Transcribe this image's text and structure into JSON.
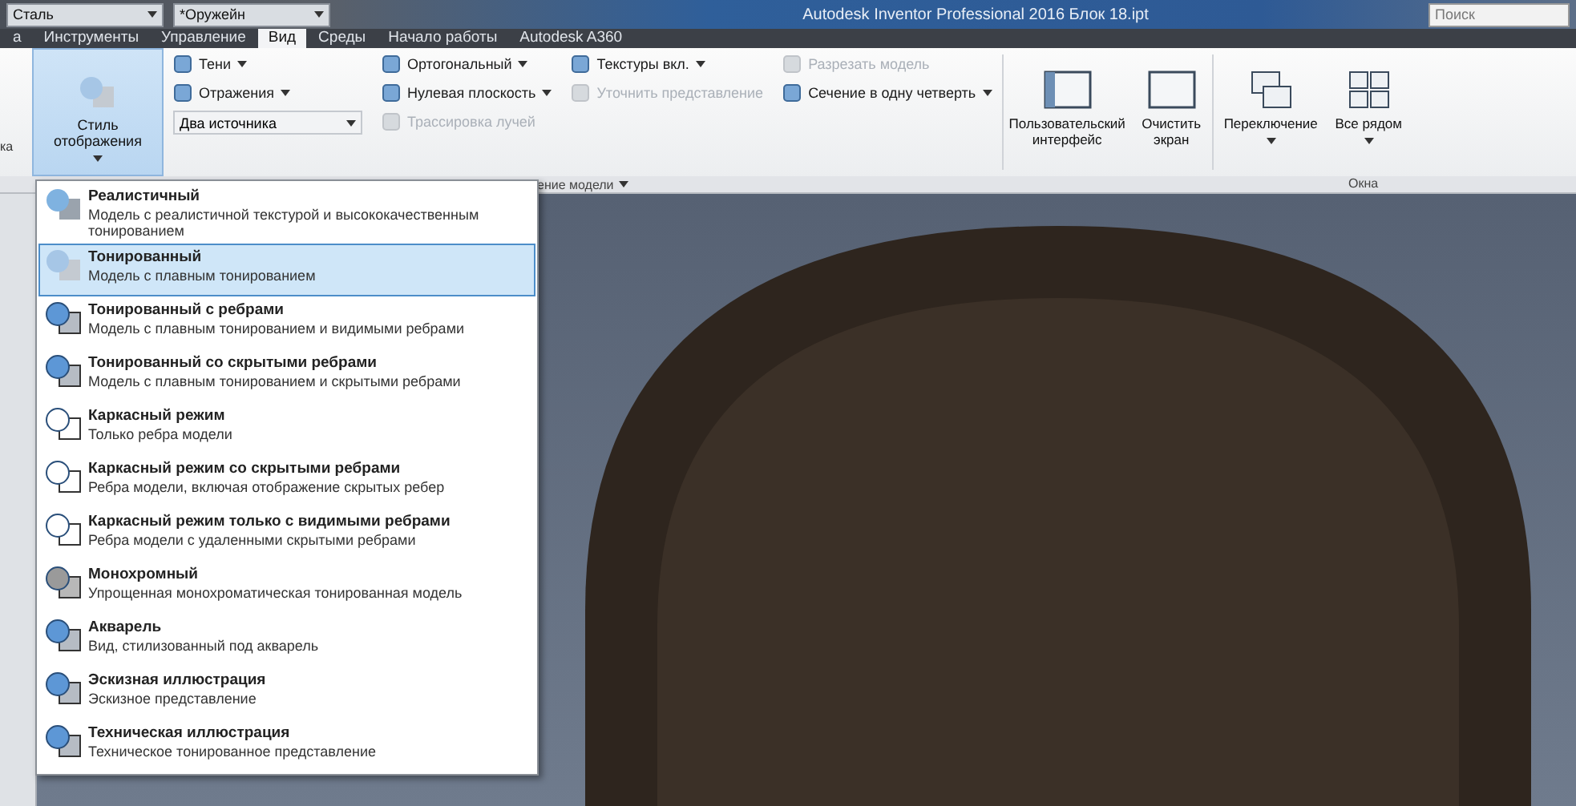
{
  "quick_access": {
    "material": "Сталь",
    "appearance": "*Оружейн"
  },
  "window": {
    "title": "Autodesk Inventor Professional 2016   Блок 18.ipt",
    "search": {
      "placeholder": "Поиск"
    }
  },
  "tabs": [
    {
      "label": "а",
      "selected": false
    },
    {
      "label": "Инструменты",
      "selected": false
    },
    {
      "label": "Управление",
      "selected": false
    },
    {
      "label": "Вид",
      "selected": true
    },
    {
      "label": "Среды",
      "selected": false
    },
    {
      "label": "Начало работы",
      "selected": false
    },
    {
      "label": "Autodesk A360",
      "selected": false
    }
  ],
  "ribbon": {
    "left_cut_label": "ка",
    "style_button": {
      "label": "Стиль отображения",
      "selected": true
    },
    "columns": [
      [
        {
          "label": "Тени",
          "has_menu": true,
          "disabled": false
        },
        {
          "label": "Отражения",
          "has_menu": true,
          "disabled": false
        }
      ],
      [
        {
          "label": "Ортогональный",
          "has_menu": true,
          "disabled": false
        },
        {
          "label": "Нулевая плоскость",
          "has_menu": true,
          "disabled": false
        },
        {
          "label": "Трассировка лучей",
          "has_menu": false,
          "disabled": true
        }
      ],
      [
        {
          "label": "Текстуры вкл.",
          "has_menu": true,
          "disabled": false
        },
        {
          "label": "Уточнить представление",
          "has_menu": false,
          "disabled": true
        }
      ],
      [
        {
          "label": "Разрезать модель",
          "has_menu": false,
          "disabled": true
        },
        {
          "label": "Сечение в одну четверть",
          "has_menu": true,
          "disabled": false
        }
      ]
    ],
    "light_dropdown": {
      "value": "Два источника"
    },
    "panel_label": "ение модели",
    "window_buttons": [
      {
        "label": "Пользовательский интерфейс"
      },
      {
        "label": "Очистить экран"
      }
    ],
    "switch_buttons": [
      {
        "label": "Переключение"
      },
      {
        "label": "Все рядом"
      }
    ],
    "windows_panel_label": "Окна"
  },
  "style_menu": [
    {
      "kind": "realistic",
      "title": "Реалистичный",
      "description": "Модель с реалистичной текстурой и высококачественным тонированием",
      "selected": false
    },
    {
      "kind": "shaded",
      "title": "Тонированный",
      "description": "Модель с плавным тонированием",
      "selected": true
    },
    {
      "kind": "edges",
      "title": "Тонированный с ребрами",
      "description": "Модель с плавным тонированием и видимыми ребрами",
      "selected": false
    },
    {
      "kind": "edges",
      "title": "Тонированный со скрытыми ребрами",
      "description": "Модель с плавным тонированием и скрытыми ребрами",
      "selected": false
    },
    {
      "kind": "wire",
      "title": "Каркасный режим",
      "description": "Только ребра модели",
      "selected": false
    },
    {
      "kind": "wire",
      "title": "Каркасный режим со скрытыми ребрами",
      "description": "Ребра модели, включая отображение скрытых ребер",
      "selected": false
    },
    {
      "kind": "wire",
      "title": "Каркасный режим только с видимыми ребрами",
      "description": "Ребра модели с удаленными скрытыми ребрами",
      "selected": false
    },
    {
      "kind": "mono",
      "title": "Монохромный",
      "description": "Упрощенная монохроматическая тонированная модель",
      "selected": false
    },
    {
      "kind": "edges",
      "title": "Акварель",
      "description": "Вид, стилизованный под акварель",
      "selected": false
    },
    {
      "kind": "edges",
      "title": "Эскизная иллюстрация",
      "description": "Эскизное представление",
      "selected": false
    },
    {
      "kind": "edges",
      "title": "Техническая иллюстрация",
      "description": "Техническое тонированное представление",
      "selected": false
    }
  ]
}
